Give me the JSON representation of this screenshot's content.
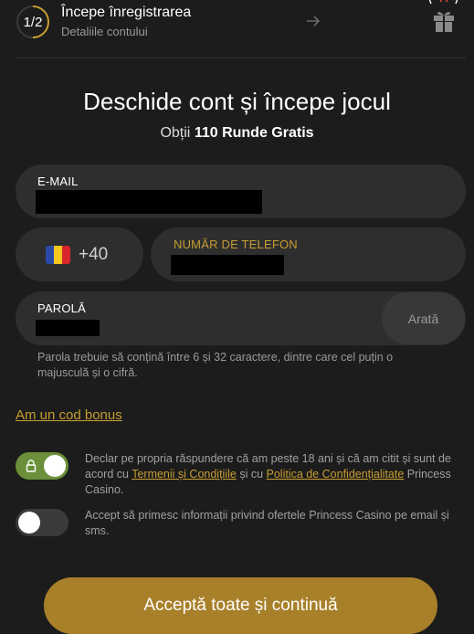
{
  "header": {
    "step_indicator": "1/2",
    "step_title": "Începe înregistrarea",
    "step_subtitle": "Detaliile contului",
    "icons": [
      "arrow-right-icon",
      "gift-icon"
    ]
  },
  "main": {
    "title": "Deschide cont și începe jocul",
    "subtitle_prefix": "Obții",
    "subtitle_bold": "110 Runde Gratis"
  },
  "form": {
    "email_label": "E-MAIL",
    "country_code": "+40",
    "country_flag": "romania-flag-icon",
    "phone_label": "NUMĂR DE TELEFON",
    "password_label": "PAROLĂ",
    "show_password": "Arată",
    "password_hint": "Parola trebuie să conțină între 6 și 32 caractere, dintre care cel puțin o majusculă și o cifră.",
    "bonus_link": "Am un cod bonus"
  },
  "consents": {
    "terms_toggle_on": true,
    "terms_text_1": "Declar pe propria răspundere că am peste 18 ani și că am citit și sunt de acord cu",
    "terms_link": "Termenii și Condițiile",
    "terms_text_2": "și cu",
    "privacy_link": "Politica de Confidențialitate",
    "terms_text_3": "Princess Casino.",
    "marketing_toggle_on": false,
    "marketing_text": "Accept să primesc informații privind ofertele Princess Casino pe email și sms."
  },
  "cta": {
    "label": "Acceptă toate și continuă"
  },
  "colors": {
    "background": "#1c1c1c",
    "field": "#2e2e2e",
    "accent_gold": "#c79d33",
    "cta": "#a8802a",
    "toggle_on": "#6b8f3a"
  }
}
